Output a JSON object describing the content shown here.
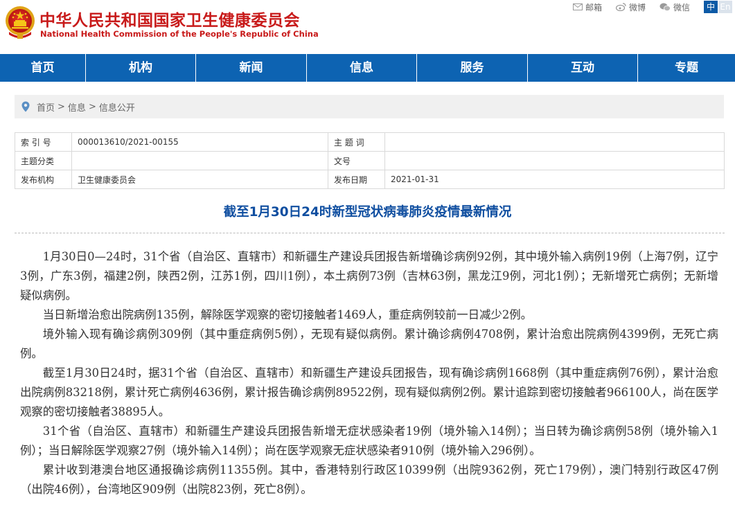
{
  "header": {
    "title_cn": "中华人民共和国国家卫生健康委员会",
    "title_en": "National Health Commission of the People's Republic of China",
    "links": [
      {
        "label": "邮箱",
        "icon": "mail-icon"
      },
      {
        "label": "微博",
        "icon": "weibo-icon"
      },
      {
        "label": "微信",
        "icon": "wechat-icon"
      }
    ],
    "lang_cn": "中",
    "lang_en": "En"
  },
  "nav": {
    "items": [
      "首页",
      "机构",
      "新闻",
      "信息",
      "服务",
      "互动",
      "专题"
    ]
  },
  "breadcrumb": {
    "items": [
      "首页",
      "信息",
      "信息公开"
    ],
    "separator": ">"
  },
  "meta": {
    "index_label": "索 引 号",
    "index_value": "000013610/2021-00155",
    "keyword_label": "主 题 词",
    "keyword_value": "",
    "category_label": "主题分类",
    "category_value": "",
    "docno_label": "文号",
    "docno_value": "",
    "publisher_label": "发布机构",
    "publisher_value": "卫生健康委员会",
    "date_label": "发布日期",
    "date_value": "2021-01-31"
  },
  "article": {
    "title": "截至1月30日24时新型冠状病毒肺炎疫情最新情况",
    "paragraphs": [
      "1月30日0—24时，31个省（自治区、直辖市）和新疆生产建设兵团报告新增确诊病例92例，其中境外输入病例19例（上海7例，辽宁3例，广东3例，福建2例，陕西2例，江苏1例，四川1例），本土病例73例（吉林63例，黑龙江9例，河北1例）；无新增死亡病例；无新增疑似病例。",
      "当日新增治愈出院病例135例，解除医学观察的密切接触者1469人，重症病例较前一日减少2例。",
      "境外输入现有确诊病例309例（其中重症病例5例），无现有疑似病例。累计确诊病例4708例，累计治愈出院病例4399例，无死亡病例。",
      "截至1月30日24时，据31个省（自治区、直辖市）和新疆生产建设兵团报告，现有确诊病例1668例（其中重症病例76例），累计治愈出院病例83218例，累计死亡病例4636例，累计报告确诊病例89522例，现有疑似病例2例。累计追踪到密切接触者966100人，尚在医学观察的密切接触者38895人。",
      "31个省（自治区、直辖市）和新疆生产建设兵团报告新增无症状感染者19例（境外输入14例）；当日转为确诊病例58例（境外输入1例）；当日解除医学观察27例（境外输入14例）；尚在医学观察无症状感染者910例（境外输入296例）。",
      "累计收到港澳台地区通报确诊病例11355例。其中，香港特别行政区10399例（出院9362例，死亡179例），澳门特别行政区47例（出院46例），台湾地区909例（出院823例，死亡8例）。"
    ]
  },
  "colors": {
    "brand_red": "#c81a1a",
    "nav_blue": "#0d63b2",
    "title_blue": "#0f4ea0"
  }
}
